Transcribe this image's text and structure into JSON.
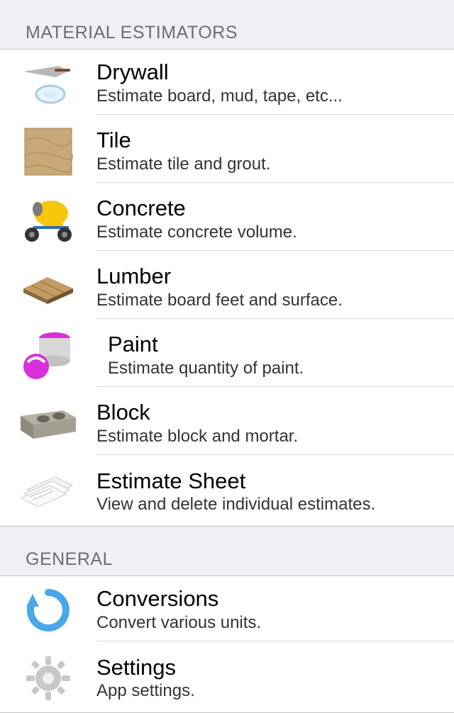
{
  "sections": [
    {
      "header": "MATERIAL ESTIMATORS",
      "items": [
        {
          "icon": "drywall",
          "title": "Drywall",
          "subtitle": "Estimate board, mud, tape, etc..."
        },
        {
          "icon": "tile",
          "title": "Tile",
          "subtitle": "Estimate tile and grout."
        },
        {
          "icon": "concrete",
          "title": "Concrete",
          "subtitle": "Estimate concrete volume."
        },
        {
          "icon": "lumber",
          "title": "Lumber",
          "subtitle": "Estimate board feet and surface."
        },
        {
          "icon": "paint",
          "title": "Paint",
          "subtitle": "Estimate quantity of paint."
        },
        {
          "icon": "block",
          "title": "Block",
          "subtitle": "Estimate block and mortar."
        },
        {
          "icon": "sheet",
          "title": "Estimate Sheet",
          "subtitle": "View and delete individual estimates."
        }
      ]
    },
    {
      "header": "GENERAL",
      "items": [
        {
          "icon": "conversions",
          "title": "Conversions",
          "subtitle": "Convert various units."
        },
        {
          "icon": "settings",
          "title": "Settings",
          "subtitle": "App settings."
        }
      ]
    }
  ]
}
